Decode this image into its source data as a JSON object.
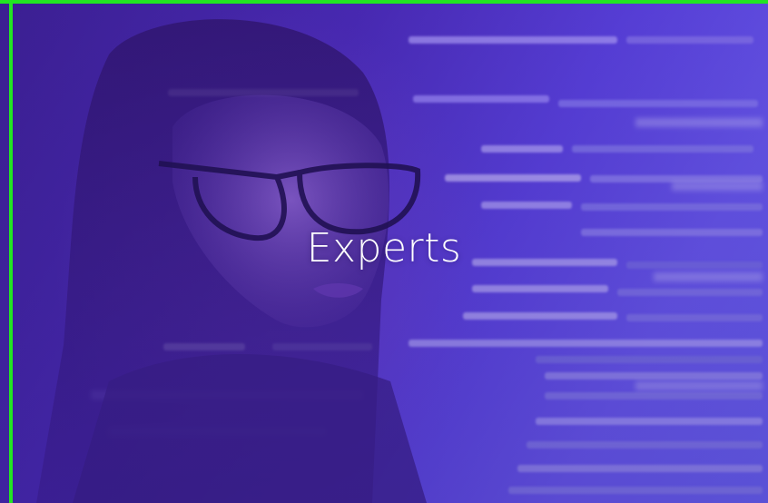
{
  "hero": {
    "heading": "Experts",
    "background_image": "woman-with-glasses-viewing-code-photo",
    "overlay_color": "#4a2bb5",
    "frame_color": "#22e622"
  }
}
